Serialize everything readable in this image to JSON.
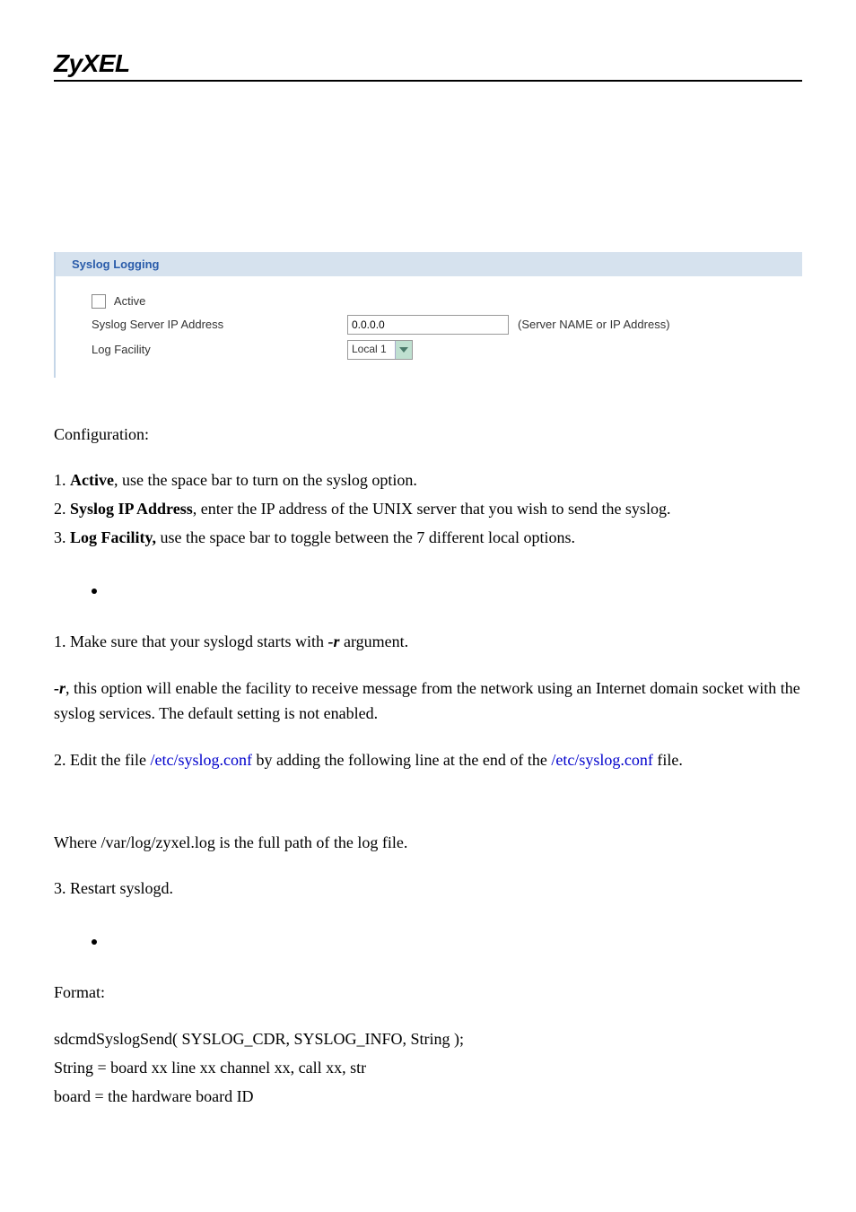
{
  "logo": "ZyXEL",
  "panel": {
    "title": "Syslog Logging",
    "active_label": "Active",
    "ip_label": "Syslog Server IP Address",
    "ip_value": "0.0.0.0",
    "ip_hint": "(Server NAME or IP Address)",
    "facility_label": "Log Facility",
    "facility_value": "Local 1"
  },
  "config": {
    "heading": "Configuration:",
    "item1_bold": "Active",
    "item1_rest": ", use the space bar to turn on the syslog option.",
    "item2_bold": "Syslog IP Address",
    "item2_rest": ", enter the IP address of the UNIX server that you wish to send the syslog.",
    "item3_bold": "Log Facility,",
    "item3_rest": " use the space bar to toggle between the 7 different local options."
  },
  "unix": {
    "step1_a": "1. Make sure that your syslogd starts with ",
    "step1_flag": "-r",
    "step1_b": " argument.",
    "r_para_flag": "-r",
    "r_para_rest": ", this option will enable the facility to receive message from the network using an Internet domain socket with the syslog services. The default setting is not enabled.",
    "step2_a": "2. Edit the file ",
    "step2_path1": "/etc/syslog.conf",
    "step2_b": " by adding the following line at the end of the ",
    "step2_path2": "/etc/syslog.conf",
    "step2_c": " file.",
    "where_line": "Where /var/log/zyxel.log is the full path of the log file.",
    "step3": "3. Restart syslogd."
  },
  "format": {
    "heading": "Format:",
    "line1": "sdcmdSyslogSend( SYSLOG_CDR, SYSLOG_INFO, String );",
    "line2": "String = board xx line xx channel xx, call xx, str",
    "line3": "board = the hardware board ID"
  }
}
